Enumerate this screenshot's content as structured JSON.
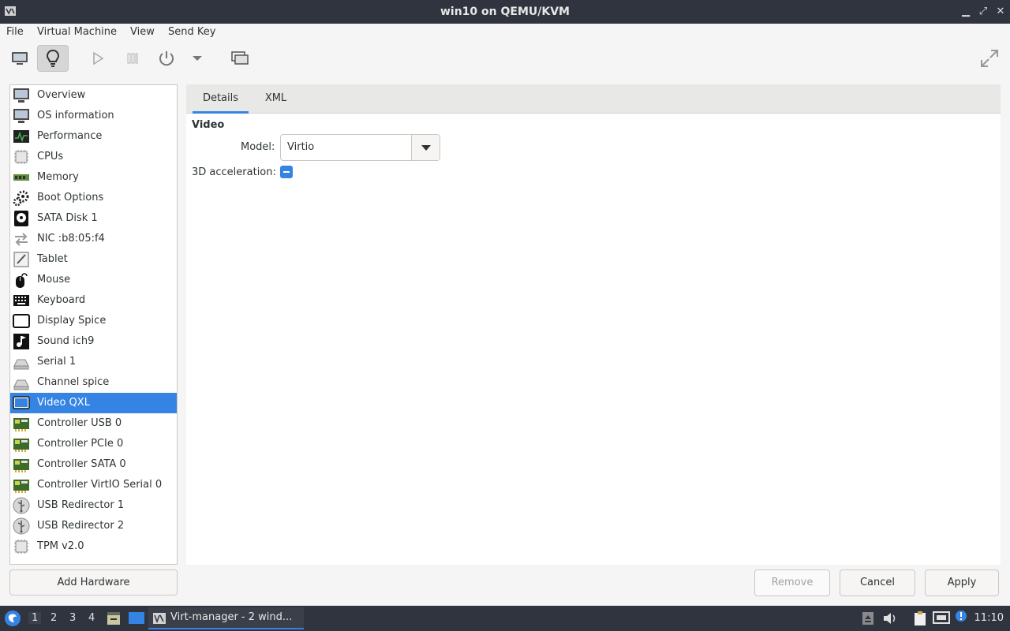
{
  "window": {
    "title": "win10 on QEMU/KVM",
    "controls": {
      "minimize": "▁",
      "maximize": "⤢",
      "close": "✕"
    }
  },
  "menubar": [
    "File",
    "Virtual Machine",
    "View",
    "Send Key"
  ],
  "toolbar": [
    {
      "name": "console-view",
      "icon": "monitor-icon"
    },
    {
      "name": "details-view",
      "icon": "lightbulb-icon",
      "active": true
    },
    {
      "name": "run",
      "icon": "play-icon"
    },
    {
      "name": "pause",
      "icon": "pause-icon"
    },
    {
      "name": "shutdown",
      "icon": "power-icon"
    },
    {
      "name": "shutdown-menu",
      "icon": "dropdown-arrow-icon"
    },
    {
      "name": "snapshots",
      "icon": "snapshots-icon"
    },
    {
      "name": "fullscreen",
      "icon": "fullscreen-icon"
    }
  ],
  "sidebar": {
    "items": [
      {
        "label": "Overview",
        "icon": "monitor-icon"
      },
      {
        "label": "OS information",
        "icon": "monitor-icon"
      },
      {
        "label": "Performance",
        "icon": "performance-icon"
      },
      {
        "label": "CPUs",
        "icon": "cpu-icon"
      },
      {
        "label": "Memory",
        "icon": "memory-icon"
      },
      {
        "label": "Boot Options",
        "icon": "gears-icon"
      },
      {
        "label": "SATA Disk 1",
        "icon": "disk-icon"
      },
      {
        "label": "NIC :b8:05:f4",
        "icon": "network-icon"
      },
      {
        "label": "Tablet",
        "icon": "tablet-icon"
      },
      {
        "label": "Mouse",
        "icon": "mouse-icon"
      },
      {
        "label": "Keyboard",
        "icon": "keyboard-icon"
      },
      {
        "label": "Display Spice",
        "icon": "display-icon"
      },
      {
        "label": "Sound ich9",
        "icon": "sound-icon"
      },
      {
        "label": "Serial 1",
        "icon": "serial-icon"
      },
      {
        "label": "Channel spice",
        "icon": "serial-icon"
      },
      {
        "label": "Video QXL",
        "icon": "video-icon",
        "selected": true
      },
      {
        "label": "Controller USB 0",
        "icon": "controller-icon"
      },
      {
        "label": "Controller PCIe 0",
        "icon": "controller-icon"
      },
      {
        "label": "Controller SATA 0",
        "icon": "controller-icon"
      },
      {
        "label": "Controller VirtIO Serial 0",
        "icon": "controller-icon"
      },
      {
        "label": "USB Redirector 1",
        "icon": "usb-icon"
      },
      {
        "label": "USB Redirector 2",
        "icon": "usb-icon"
      },
      {
        "label": "TPM v2.0",
        "icon": "cpu-icon"
      }
    ],
    "add_hardware_label": "Add Hardware"
  },
  "main": {
    "tabs": [
      {
        "label": "Details",
        "active": true
      },
      {
        "label": "XML"
      }
    ],
    "section_title": "Video",
    "model_label": "Model:",
    "model_value": "Virtio",
    "accel_label": "3D acceleration:",
    "accel_state": "indeterminate"
  },
  "buttons": {
    "remove": "Remove",
    "cancel": "Cancel",
    "apply": "Apply"
  },
  "taskbar": {
    "workspaces": [
      "1",
      "2",
      "3",
      "4"
    ],
    "active_workspace": "1",
    "task_label": "Virt-manager - 2 wind...",
    "clock": "11:10"
  },
  "colors": {
    "accent": "#3584e4",
    "titlebar": "#2f343f",
    "panel_bg": "#f5f5f5"
  }
}
